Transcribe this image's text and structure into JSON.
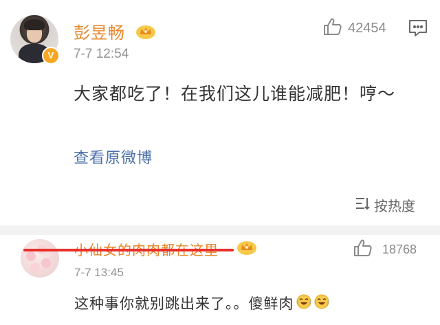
{
  "post": {
    "username": "彭昱畅",
    "timestamp": "7-7 12:54",
    "like_count": "42454",
    "verified_badge": "V",
    "content": "大家都吃了！在我们这儿谁能减肥！哼～",
    "view_original": "查看原微博"
  },
  "sort": {
    "label": "按热度"
  },
  "comment": {
    "username": "小仙女的肉肉都在这里",
    "timestamp": "7-7 13:45",
    "like_count": "18768",
    "text": "这种事你就别跳出来了。。傻鲜肉"
  },
  "colors": {
    "username": "#e8862a",
    "link": "#4a6fa8",
    "redact": "#e8302a",
    "badge": "#f6a623"
  },
  "icons": {
    "crown": "crown-icon",
    "like": "thumbs-up-icon",
    "comment": "comment-icon",
    "sort": "sort-icon",
    "emoji": "laughing-crying-emoji"
  }
}
